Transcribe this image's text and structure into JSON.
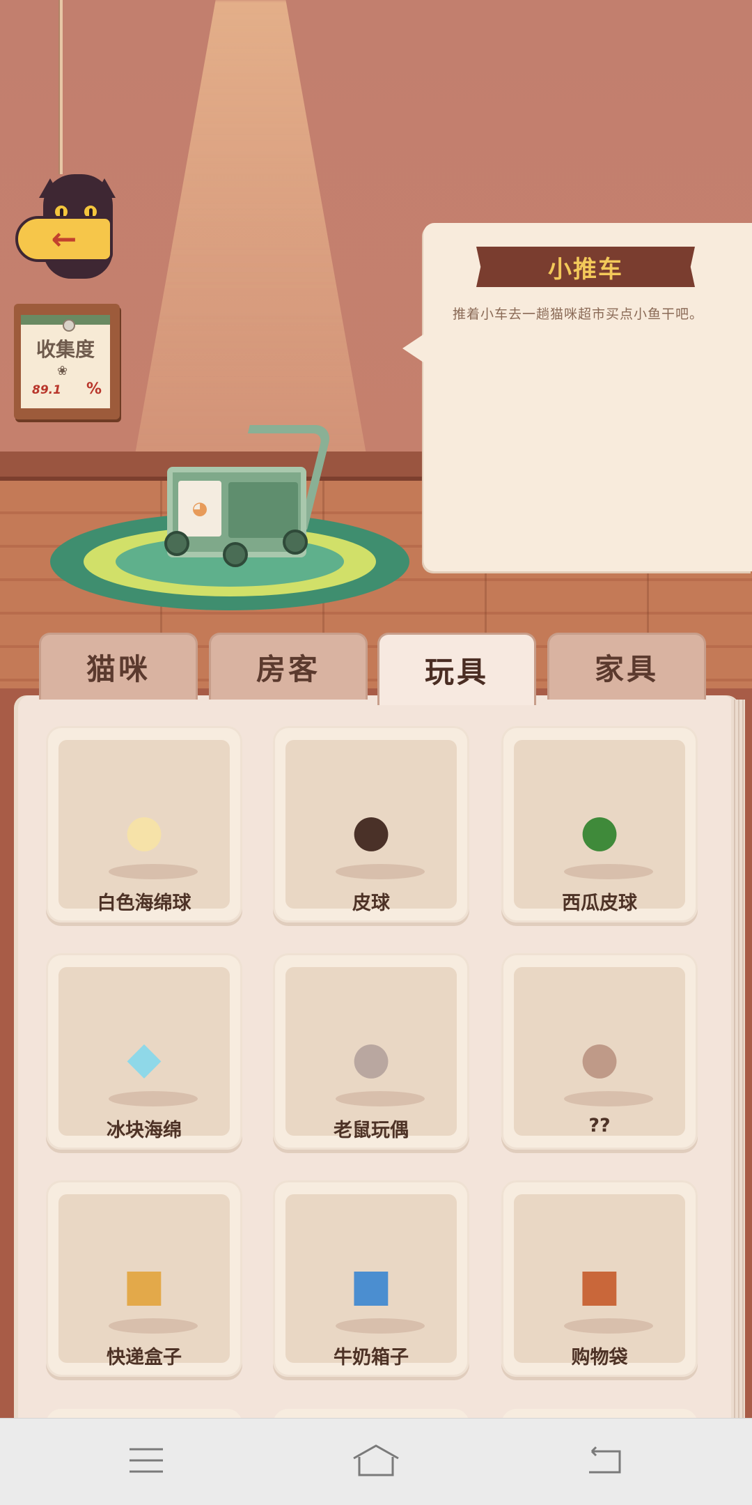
{
  "collection": {
    "title": "收集度",
    "value": "89.1",
    "unit": "%"
  },
  "selected_item": {
    "name": "小推车",
    "description": "推着小车去一趟猫咪超市买点小鱼干吧。"
  },
  "tabs": [
    {
      "label": "猫咪",
      "active": false
    },
    {
      "label": "房客",
      "active": false
    },
    {
      "label": "玩具",
      "active": true
    },
    {
      "label": "家具",
      "active": false
    }
  ],
  "items": [
    {
      "label": "白色海绵球",
      "icon": "white-sponge-ball-icon",
      "glyph": "●",
      "color": "#f6e2a8"
    },
    {
      "label": "皮球",
      "icon": "leather-ball-icon",
      "glyph": "●",
      "color": "#4a3128"
    },
    {
      "label": "西瓜皮球",
      "icon": "watermelon-ball-icon",
      "glyph": "●",
      "color": "#3f8a3a"
    },
    {
      "label": "冰块海绵",
      "icon": "ice-cube-sponge-icon",
      "glyph": "◆",
      "color": "#8fd8e8"
    },
    {
      "label": "老鼠玩偶",
      "icon": "mouse-toy-icon",
      "glyph": "●",
      "color": "#b9a7a0"
    },
    {
      "label": "??",
      "icon": "locked-item-icon",
      "glyph": "●",
      "color": "#bf9a88"
    },
    {
      "label": "快递盒子",
      "icon": "delivery-box-icon",
      "glyph": "■",
      "color": "#e3a94a"
    },
    {
      "label": "牛奶箱子",
      "icon": "milk-box-icon",
      "glyph": "■",
      "color": "#4b8ed0"
    },
    {
      "label": "购物袋",
      "icon": "shopping-bag-icon",
      "glyph": "■",
      "color": "#c9673a"
    }
  ],
  "icons": {
    "back": "←",
    "paw": "❀",
    "cart_face": "◕"
  }
}
